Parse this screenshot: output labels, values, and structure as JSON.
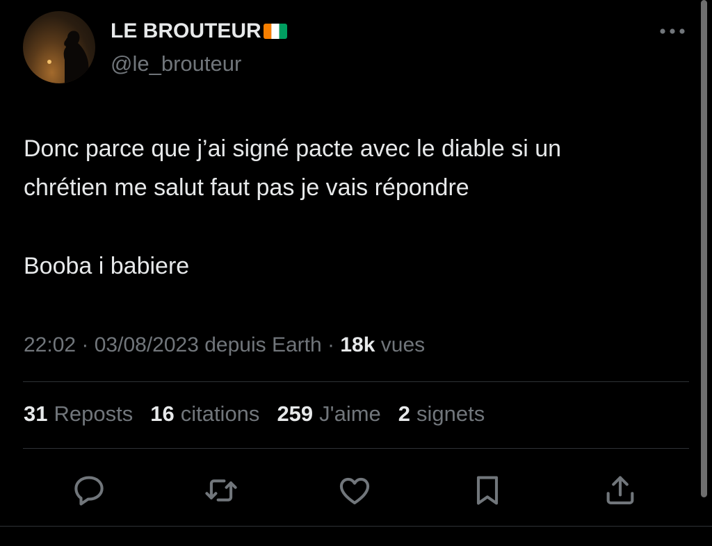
{
  "author": {
    "display_name": "LE BROUTEUR",
    "flag_icon": "ivory-coast-flag-icon",
    "handle": "@le_brouteur",
    "avatar_icon": "avatar-silhouette-sunset"
  },
  "tweet": {
    "lines": [
      "Donc parce que j’ai signé pacte avec le diable si un",
      "chrétien me salut faut pas je vais répondre"
    ],
    "line2": "Booba i babiere"
  },
  "meta": {
    "time": "22:02",
    "separator1": " · ",
    "date": "03/08/2023",
    "source": " depuis Earth",
    "separator2": " · ",
    "views_count": "18k",
    "views_label": " vues"
  },
  "stats": [
    {
      "count": "31",
      "label": "Reposts"
    },
    {
      "count": "16",
      "label": "citations"
    },
    {
      "count": "259",
      "label": "J'aime"
    },
    {
      "count": "2",
      "label": "signets"
    }
  ],
  "actions": [
    "reply-icon",
    "repost-icon",
    "like-icon",
    "bookmark-icon",
    "share-icon"
  ],
  "colors": {
    "background": "#000000",
    "text_primary": "#e7e9ea",
    "text_secondary": "#71767b",
    "divider": "#2f3336",
    "flag_orange": "#f77f00",
    "flag_green": "#009e60"
  }
}
